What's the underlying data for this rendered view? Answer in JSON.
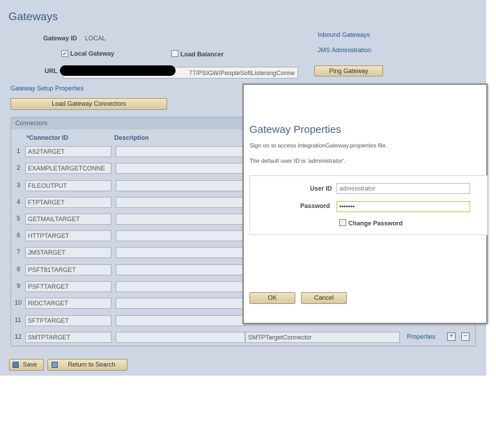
{
  "page": {
    "title": "Gateways",
    "gateway_id_label": "Gateway ID",
    "gateway_id_value": "LOCAL",
    "local_gateway_label": "Local Gateway",
    "load_balancer_label": "Load Balancer",
    "url_label": "URL",
    "url_value": "77/PSIGW/PeopleSoftListeningConne",
    "inbound_gateways_link": "Inbound Gateways",
    "jms_admin_link": "JMS Administration",
    "ping_gateway_button": "Ping Gateway",
    "setup_properties_link": "Gateway Setup Properties",
    "load_connectors_button": "Load Gateway Connectors"
  },
  "grid": {
    "title": "Connectors",
    "headers": {
      "connector_id": "*Connector ID",
      "description": "Description"
    },
    "rows": [
      {
        "num": "1",
        "id": "AS2TARGET"
      },
      {
        "num": "2",
        "id": "EXAMPLETARGETCONNE"
      },
      {
        "num": "3",
        "id": "FILEOUTPUT"
      },
      {
        "num": "4",
        "id": "FTPTARGET"
      },
      {
        "num": "5",
        "id": "GETMAILTARGET"
      },
      {
        "num": "6",
        "id": "HTTPTARGET"
      },
      {
        "num": "7",
        "id": "JMSTARGET"
      },
      {
        "num": "8",
        "id": "PSFT81TARGET"
      },
      {
        "num": "9",
        "id": "PSFTTARGET"
      },
      {
        "num": "10",
        "id": "RIDCTARGET"
      },
      {
        "num": "11",
        "id": "SFTPTARGET"
      },
      {
        "num": "12",
        "id": "SMTPTARGET"
      }
    ],
    "last_row_class": "SMTPTargetConnector",
    "properties_link": "Properties",
    "add_symbol": "+",
    "remove_symbol": "−"
  },
  "footer": {
    "save_button": "Save",
    "return_button": "Return to Search"
  },
  "dialog": {
    "title": "Gateway Properties",
    "line1": "Sign on to access integrationGateway.properties file.",
    "line2": "The default user ID is 'administrator'.",
    "user_id_label": "User ID",
    "user_id_value": "administrator",
    "password_label": "Password",
    "password_value": "•••••••",
    "change_password_label": "Change Password",
    "ok_button": "OK",
    "cancel_button": "Cancel"
  },
  "colors": {
    "page_background": "#cdd6e2",
    "title_blue": "#3f5f88",
    "button_tan": "#e3d6b2"
  }
}
